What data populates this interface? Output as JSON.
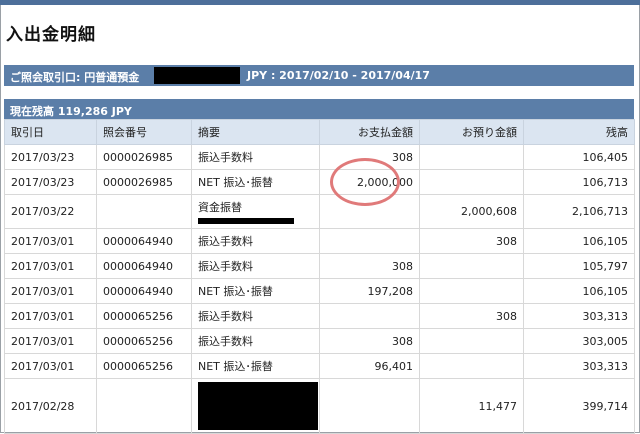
{
  "page": {
    "title": "入出金明細"
  },
  "account": {
    "label": "ご照会取引口: 円普通預金",
    "period": "JPY : 2017/02/10 - 2017/04/17"
  },
  "balance": {
    "label": "現在残高 119,286 JPY"
  },
  "table": {
    "headers": [
      "取引日",
      "照会番号",
      "摘要",
      "お支払金額",
      "お預り金額",
      "残高"
    ],
    "rows": [
      {
        "date": "2017/03/23",
        "ref": "0000026985",
        "desc": "振込手数料",
        "payment": "308",
        "deposit": "",
        "balance": "106,405"
      },
      {
        "date": "2017/03/23",
        "ref": "0000026985",
        "desc": "NET 振込･振替",
        "payment": "2,000,000",
        "deposit": "",
        "balance": "106,713"
      },
      {
        "date": "2017/03/22",
        "ref": "",
        "desc": "資金振替",
        "payment": "",
        "deposit": "2,000,608",
        "balance": "2,106,713"
      },
      {
        "date": "2017/03/01",
        "ref": "0000064940",
        "desc": "振込手数料",
        "payment": "",
        "deposit": "308",
        "balance": "106,105"
      },
      {
        "date": "2017/03/01",
        "ref": "0000064940",
        "desc": "振込手数料",
        "payment": "308",
        "deposit": "",
        "balance": "105,797"
      },
      {
        "date": "2017/03/01",
        "ref": "0000064940",
        "desc": "NET 振込･振替",
        "payment": "197,208",
        "deposit": "",
        "balance": "106,105"
      },
      {
        "date": "2017/03/01",
        "ref": "0000065256",
        "desc": "振込手数料",
        "payment": "",
        "deposit": "308",
        "balance": "303,313"
      },
      {
        "date": "2017/03/01",
        "ref": "0000065256",
        "desc": "振込手数料",
        "payment": "308",
        "deposit": "",
        "balance": "303,005"
      },
      {
        "date": "2017/03/01",
        "ref": "0000065256",
        "desc": "NET 振込･振替",
        "payment": "96,401",
        "deposit": "",
        "balance": "303,313"
      },
      {
        "date": "2017/02/28",
        "ref": "",
        "desc": "",
        "payment": "",
        "deposit": "11,477",
        "balance": "399,714"
      }
    ]
  },
  "colors": {
    "header_bar": "#5b7ea8",
    "table_header": "#dbe5f1",
    "annotation_circle": "#e07a7a"
  }
}
